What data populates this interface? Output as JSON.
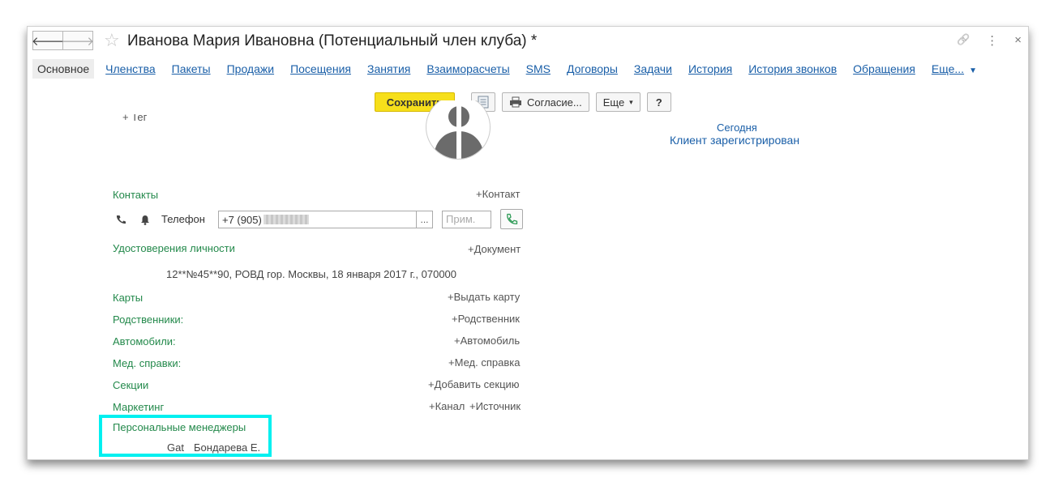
{
  "window": {
    "title": "Иванова Мария Ивановна (Потенциальный член клуба) *",
    "back_glyph": "🡐",
    "forward_glyph": "🡒",
    "star_glyph": "☆",
    "link_glyph": "🔗",
    "menu_glyph": "⋮",
    "close_glyph": "×"
  },
  "tabs": {
    "items": [
      {
        "label": "Основное",
        "active": true
      },
      {
        "label": "Членства"
      },
      {
        "label": "Пакеты"
      },
      {
        "label": "Продажи"
      },
      {
        "label": "Посещения"
      },
      {
        "label": "Занятия"
      },
      {
        "label": "Взаиморасчеты"
      },
      {
        "label": "SMS"
      },
      {
        "label": "Договоры"
      },
      {
        "label": "Задачи"
      },
      {
        "label": "История"
      },
      {
        "label": "История звонков"
      },
      {
        "label": "Обращения"
      }
    ],
    "more_label": "Еще...",
    "more_caret": "▼"
  },
  "toolbar": {
    "save_label": "Сохранить",
    "consent_label": "Согласие...",
    "more_label": "Еще",
    "more_caret": "▾",
    "help_label": "?"
  },
  "form": {
    "tag_label": "+ Тег",
    "status_date": "Сегодня",
    "status_text": "Клиент зарегистрирован",
    "contacts_label": "Контакты",
    "add_contact": "+Контакт",
    "phone_label": "Телефон",
    "phone_value": "+7 (905)",
    "phone_dots": "...",
    "prim_placeholder": "Прим.",
    "id_docs_label": "Удостоверения личности",
    "add_document": "+Документ",
    "document_text": "12**№45**90, РОВД гор. Москвы, 18 января 2017 г., 070000",
    "cards_label": "Карты",
    "add_card": "+Выдать карту",
    "relatives_label": "Родственники:",
    "add_relative": "+Родственник",
    "cars_label": "Автомобили:",
    "add_car": "+Автомобиль",
    "med_label": "Мед. справки:",
    "add_med": "+Мед. справка",
    "sections_label": "Секции",
    "add_section": "+Добавить секцию",
    "marketing_label": "Маркетинг",
    "add_channel": "+Канал",
    "add_source": "+Источник",
    "managers_label": "Персональные менеджеры",
    "manager_tag": "Gat",
    "manager_name": "Бондарева Е."
  },
  "colors": {
    "accent_green": "#23894b",
    "link_blue": "#1a5fa8",
    "save_yellow": "#f6df1b",
    "highlight": "#00f0f0"
  }
}
